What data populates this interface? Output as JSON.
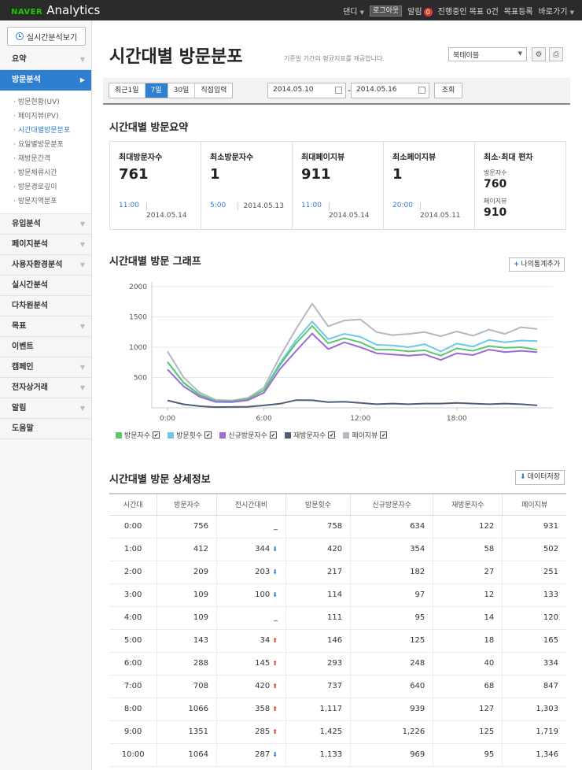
{
  "topbar": {
    "brand": "NAVER",
    "product": "Analytics",
    "user": "댄디",
    "logout": "로그아웃",
    "alarm": "알림",
    "alarm_count": "0",
    "goal_status": "진행중인 목표 0건",
    "goal_register": "목표등록",
    "shortcut": "바로가기"
  },
  "sidebar": {
    "realtime_button": "실시간분석보기",
    "items": [
      {
        "label": "요약"
      },
      {
        "label": "방문분석"
      },
      {
        "label": "유입분석"
      },
      {
        "label": "페이지분석"
      },
      {
        "label": "사용자환경분석"
      },
      {
        "label": "실시간분석"
      },
      {
        "label": "다차원분석"
      },
      {
        "label": "목표"
      },
      {
        "label": "이벤트"
      },
      {
        "label": "캠페인"
      },
      {
        "label": "전자상거래"
      },
      {
        "label": "알림"
      },
      {
        "label": "도움말"
      }
    ],
    "sub_items": [
      {
        "label": "방문현황(UV)"
      },
      {
        "label": "페이지뷰(PV)"
      },
      {
        "label": "시간대별방문분포"
      },
      {
        "label": "요일별방문분포"
      },
      {
        "label": "재방문간격"
      },
      {
        "label": "방문체류시간"
      },
      {
        "label": "방문경로깊이"
      },
      {
        "label": "방문지역분포"
      }
    ]
  },
  "header": {
    "title": "시간대별 방문분포",
    "desc": "기준일 기간의 평균지표를 제공합니다.",
    "site_select": "북테이블"
  },
  "filter": {
    "tabs": [
      "최근1일",
      "7일",
      "30일",
      "직접입력"
    ],
    "active_tab": "7일",
    "start_date": "2014.05.10",
    "end_date": "2014.05.16",
    "search_button": "조회"
  },
  "summary": {
    "title": "시간대별 방문요약",
    "max_visitors": {
      "label": "최대방문자수",
      "value": "761",
      "time": "11:00",
      "date": "2014.05.14"
    },
    "min_visitors": {
      "label": "최소방문자수",
      "value": "1",
      "time": "5:00",
      "date": "2014.05.13"
    },
    "max_pageviews": {
      "label": "최대페이지뷰",
      "value": "911",
      "time": "11:00",
      "date": "2014.05.14"
    },
    "min_pageviews": {
      "label": "최소페이지뷰",
      "value": "1",
      "time": "20:00",
      "date": "2014.05.11"
    },
    "deviation": {
      "label": "최소·최대 편차",
      "visitors_label": "방문자수",
      "visitors_value": "760",
      "pageviews_label": "페이지뷰",
      "pageviews_value": "910"
    }
  },
  "graph": {
    "title": "시간대별 방문 그래프",
    "add_button": "나의통계추가"
  },
  "chart_data": {
    "type": "line",
    "x": [
      "0:00",
      "1:00",
      "2:00",
      "3:00",
      "4:00",
      "5:00",
      "6:00",
      "7:00",
      "8:00",
      "9:00",
      "10:00",
      "11:00",
      "12:00",
      "13:00",
      "14:00",
      "15:00",
      "16:00",
      "17:00",
      "18:00",
      "19:00",
      "20:00",
      "21:00",
      "22:00",
      "23:00"
    ],
    "xticks": [
      "0:00",
      "6:00",
      "12:00",
      "18:00"
    ],
    "yticks": [
      500,
      1000,
      1500,
      2000
    ],
    "ylim": [
      0,
      2000
    ],
    "series": [
      {
        "name": "방문자수",
        "color": "#5bc96b",
        "values": [
          756,
          412,
          209,
          109,
          109,
          143,
          288,
          708,
          1066,
          1351,
          1064,
          1150,
          1080,
          960,
          960,
          930,
          950,
          860,
          980,
          940,
          1020,
          990,
          1000,
          960
        ]
      },
      {
        "name": "방문횟수",
        "color": "#6cc9e8",
        "values": [
          758,
          420,
          217,
          114,
          111,
          146,
          293,
          737,
          1117,
          1425,
          1133,
          1220,
          1170,
          1040,
          1030,
          1000,
          1050,
          930,
          1060,
          1010,
          1120,
          1080,
          1110,
          1100
        ]
      },
      {
        "name": "신규방문자수",
        "color": "#9b6bd8",
        "values": [
          634,
          354,
          182,
          97,
          95,
          125,
          248,
          640,
          939,
          1226,
          969,
          1080,
          1000,
          900,
          880,
          860,
          880,
          790,
          900,
          870,
          960,
          920,
          940,
          920
        ]
      },
      {
        "name": "재방문자수",
        "color": "#4f5d75",
        "values": [
          122,
          58,
          27,
          12,
          14,
          18,
          40,
          68,
          127,
          125,
          95,
          100,
          80,
          60,
          70,
          60,
          70,
          70,
          80,
          70,
          60,
          70,
          60,
          40
        ]
      },
      {
        "name": "페이지뷰",
        "color": "#b5b8c0",
        "values": [
          931,
          502,
          251,
          133,
          120,
          165,
          334,
          847,
          1303,
          1719,
          1346,
          1440,
          1460,
          1250,
          1200,
          1220,
          1250,
          1180,
          1260,
          1190,
          1290,
          1220,
          1330,
          1300
        ]
      }
    ]
  },
  "detail": {
    "title": "시간대별 방문 상세정보",
    "save_button": "데이터저장",
    "columns": [
      "시간대",
      "방문자수",
      "전시간대비",
      "방문횟수",
      "신규방문자수",
      "재방문자수",
      "페이지뷰"
    ],
    "rows": [
      {
        "time": "0:00",
        "visitors": "756",
        "diff": "_",
        "dir": "",
        "visits": "758",
        "new": "634",
        "returning": "122",
        "pv": "931"
      },
      {
        "time": "1:00",
        "visitors": "412",
        "diff": "344",
        "dir": "down",
        "visits": "420",
        "new": "354",
        "returning": "58",
        "pv": "502"
      },
      {
        "time": "2:00",
        "visitors": "209",
        "diff": "203",
        "dir": "down",
        "visits": "217",
        "new": "182",
        "returning": "27",
        "pv": "251"
      },
      {
        "time": "3:00",
        "visitors": "109",
        "diff": "100",
        "dir": "down",
        "visits": "114",
        "new": "97",
        "returning": "12",
        "pv": "133"
      },
      {
        "time": "4:00",
        "visitors": "109",
        "diff": "_",
        "dir": "",
        "visits": "111",
        "new": "95",
        "returning": "14",
        "pv": "120"
      },
      {
        "time": "5:00",
        "visitors": "143",
        "diff": "34",
        "dir": "up",
        "visits": "146",
        "new": "125",
        "returning": "18",
        "pv": "165"
      },
      {
        "time": "6:00",
        "visitors": "288",
        "diff": "145",
        "dir": "up",
        "visits": "293",
        "new": "248",
        "returning": "40",
        "pv": "334"
      },
      {
        "time": "7:00",
        "visitors": "708",
        "diff": "420",
        "dir": "up",
        "visits": "737",
        "new": "640",
        "returning": "68",
        "pv": "847"
      },
      {
        "time": "8:00",
        "visitors": "1066",
        "diff": "358",
        "dir": "up",
        "visits": "1,117",
        "new": "939",
        "returning": "127",
        "pv": "1,303"
      },
      {
        "time": "9:00",
        "visitors": "1351",
        "diff": "285",
        "dir": "up",
        "visits": "1,425",
        "new": "1,226",
        "returning": "125",
        "pv": "1,719"
      },
      {
        "time": "10:00",
        "visitors": "1064",
        "diff": "287",
        "dir": "down",
        "visits": "1,133",
        "new": "969",
        "returning": "95",
        "pv": "1,346"
      }
    ]
  }
}
